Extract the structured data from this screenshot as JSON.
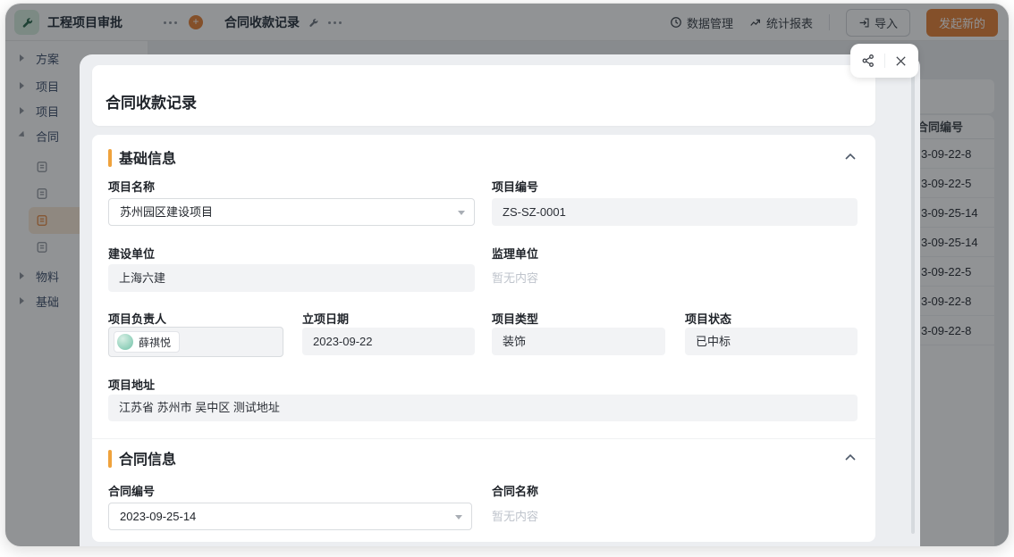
{
  "colors": {
    "accent": "#E8833A",
    "section_bar": "#EFA23C",
    "selected_item_bg": "#FCEBD8",
    "selected_item_icon": "#E8873C",
    "avatar": "#9AD4C0",
    "band_left": "#D7E9EC",
    "band_mid": "#F5EFDA",
    "band_right": "#DDE9EF"
  },
  "header": {
    "app_title": "工程项目审批",
    "page_title": "合同收款记录",
    "data_management": "数据管理",
    "reports": "统计报表",
    "import": "导入",
    "create": "发起新的"
  },
  "sidebar": {
    "groups": [
      {
        "label": "方案"
      },
      {
        "label": "项目"
      },
      {
        "label": "项目"
      },
      {
        "label": "合同"
      },
      {
        "label": "物料"
      },
      {
        "label": "基础"
      }
    ]
  },
  "table": {
    "column_header": "合同编号",
    "rows": [
      "3-09-22-8",
      "3-09-22-5",
      "3-09-25-14",
      "3-09-25-14",
      "3-09-22-5",
      "3-09-22-8",
      "3-09-22-8"
    ]
  },
  "modal": {
    "title": "合同收款记录",
    "basic": {
      "section_title": "基础信息",
      "project_name": {
        "label": "项目名称",
        "value": "苏州园区建设项目"
      },
      "project_no": {
        "label": "项目编号",
        "value": "ZS-SZ-0001"
      },
      "builder": {
        "label": "建设单位",
        "value": "上海六建"
      },
      "supervisor": {
        "label": "监理单位",
        "value": "暂无内容"
      },
      "manager": {
        "label": "项目负责人",
        "value": "薛祺悦"
      },
      "date": {
        "label": "立项日期",
        "value": "2023-09-22"
      },
      "type": {
        "label": "项目类型",
        "value": "装饰"
      },
      "status": {
        "label": "项目状态",
        "value": "已中标"
      },
      "address": {
        "label": "项目地址",
        "value": "江苏省 苏州市 吴中区 测试地址"
      }
    },
    "contract": {
      "section_title": "合同信息",
      "contract_no": {
        "label": "合同编号",
        "value": "2023-09-25-14"
      },
      "contract_name": {
        "label": "合同名称",
        "value": "暂无内容"
      }
    }
  }
}
